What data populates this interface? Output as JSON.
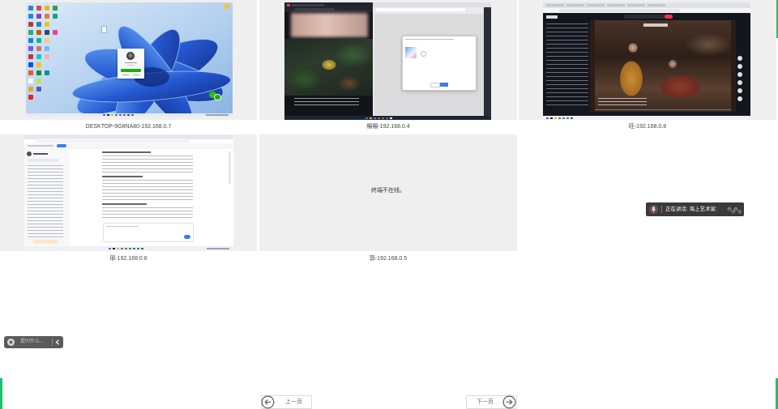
{
  "terminals": [
    {
      "caption": "DESKTOP-9G8NA80-192.168.0.7"
    },
    {
      "caption": "楊楊-192.168.0.4"
    },
    {
      "caption": "旺-192.168.0.8"
    },
    {
      "caption": "邢-192.168.0.6"
    },
    {
      "caption": "郭-192.168.0.5",
      "offline_text": "终端不在线。"
    }
  ],
  "speaking_toast": {
    "text": "正在讲话: 海上艺术家:",
    "icons": [
      "mic-icon",
      "audio-wave-icon"
    ]
  },
  "assistant_pill": {
    "text": "提问什么...",
    "icons": [
      "assistant-icon",
      "chevron-left-icon"
    ]
  },
  "pagination": {
    "prev_label": "上一页",
    "next_label": "下一页",
    "icons": [
      "arrow-left-circle-icon",
      "arrow-right-circle-icon"
    ]
  },
  "colors": {
    "accent_green": "#1fbf6e",
    "tile_background": "#efefef",
    "toast_background": "#3a3a3a",
    "pill_background": "#5b5b5b"
  }
}
